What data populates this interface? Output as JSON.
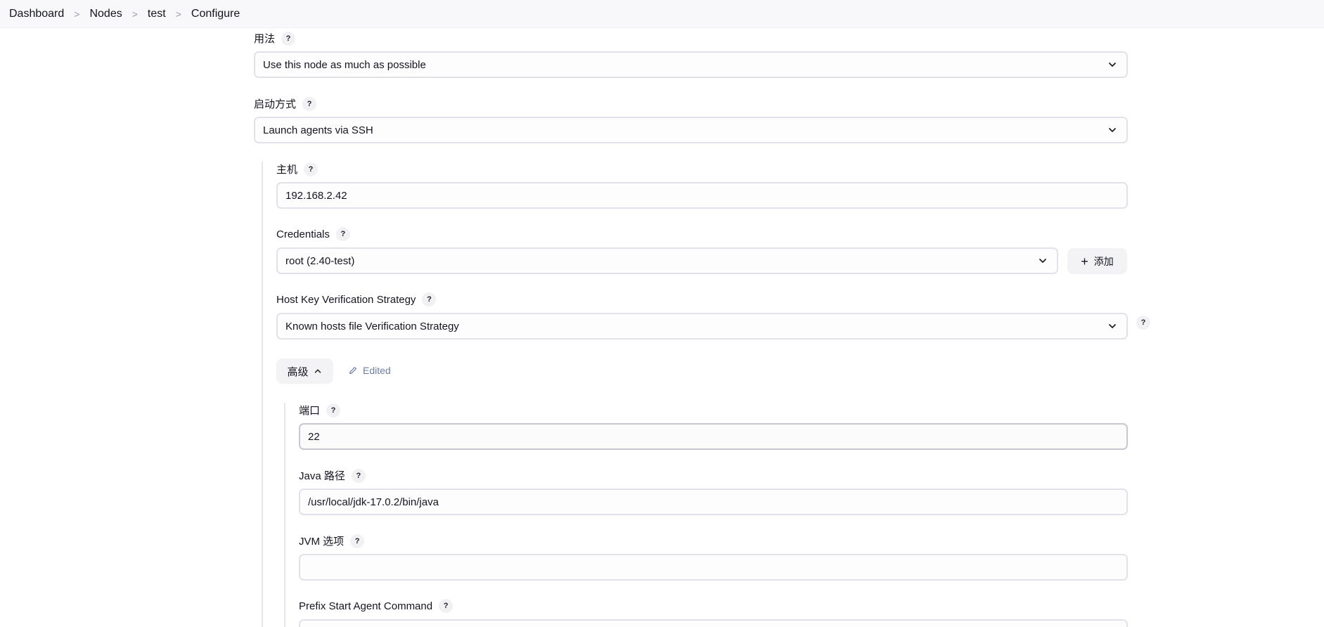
{
  "breadcrumb": {
    "items": [
      "Dashboard",
      "Nodes",
      "test",
      "Configure"
    ],
    "separator": ">"
  },
  "form": {
    "usage": {
      "label": "用法",
      "help": "?",
      "value": "Use this node as much as possible"
    },
    "launch_method": {
      "label": "启动方式",
      "help": "?",
      "value": "Launch agents via SSH"
    },
    "host": {
      "label": "主机",
      "help": "?",
      "value": "192.168.2.42"
    },
    "credentials": {
      "label": "Credentials",
      "help": "?",
      "value": "root (2.40-test)",
      "add_button": "添加"
    },
    "host_key_strategy": {
      "label": "Host Key Verification Strategy",
      "help": "?",
      "value": "Known hosts file Verification Strategy",
      "side_help": "?"
    },
    "advanced": {
      "button_label": "高级",
      "edited_label": "Edited"
    },
    "port": {
      "label": "端口",
      "help": "?",
      "value": "22"
    },
    "java_path": {
      "label": "Java 路径",
      "help": "?",
      "value": "/usr/local/jdk-17.0.2/bin/java"
    },
    "jvm_options": {
      "label": "JVM 选项",
      "help": "?",
      "value": ""
    },
    "prefix_start_agent_command": {
      "label": "Prefix Start Agent Command",
      "help": "?",
      "value": ""
    }
  },
  "icons": {
    "select": "chevron-down-icon",
    "add": "plus-icon",
    "advanced": "chevron-up-icon",
    "edited": "pencil-icon"
  },
  "colors": {
    "topbar_bg": "#f8f8fa",
    "field_border": "#e2e2ea",
    "help_bg": "#f1f1f4",
    "edited_text": "#6b7fa3"
  }
}
